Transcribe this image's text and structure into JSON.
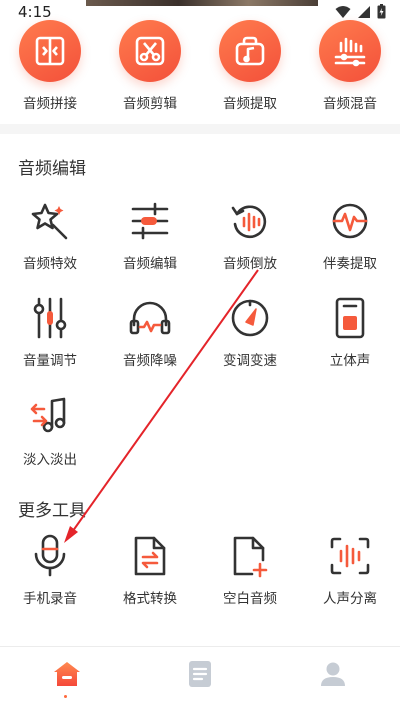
{
  "status": {
    "time": "4:15"
  },
  "top_tools": [
    {
      "label": "音频拼接",
      "icon": "splice-icon"
    },
    {
      "label": "音频剪辑",
      "icon": "scissors-icon"
    },
    {
      "label": "音频提取",
      "icon": "music-bag-icon"
    },
    {
      "label": "音频混音",
      "icon": "mixer-icon"
    }
  ],
  "audio_edit": {
    "title": "音频编辑",
    "items": [
      {
        "label": "音频特效",
        "icon": "magic-star-icon"
      },
      {
        "label": "音频编辑",
        "icon": "sliders-icon"
      },
      {
        "label": "音频倒放",
        "icon": "reverse-play-icon"
      },
      {
        "label": "伴奏提取",
        "icon": "waveform-circle-icon"
      },
      {
        "label": "音量调节",
        "icon": "volume-sliders-icon"
      },
      {
        "label": "音频降噪",
        "icon": "headphones-icon"
      },
      {
        "label": "变调变速",
        "icon": "speed-gauge-icon"
      },
      {
        "label": "立体声",
        "icon": "speaker-icon"
      },
      {
        "label": "淡入淡出",
        "icon": "fade-note-icon"
      }
    ]
  },
  "more_tools": {
    "title": "更多工具",
    "items": [
      {
        "label": "手机录音",
        "icon": "microphone-icon"
      },
      {
        "label": "格式转换",
        "icon": "file-convert-icon"
      },
      {
        "label": "空白音频",
        "icon": "file-add-icon"
      },
      {
        "label": "人声分离",
        "icon": "voice-separate-icon"
      }
    ]
  },
  "nav": {
    "items": [
      "home-icon",
      "document-icon",
      "profile-icon"
    ],
    "active_color": "#ff6a3d"
  },
  "colors": {
    "accent": "#f55a3c",
    "icon_dark": "#333333"
  }
}
